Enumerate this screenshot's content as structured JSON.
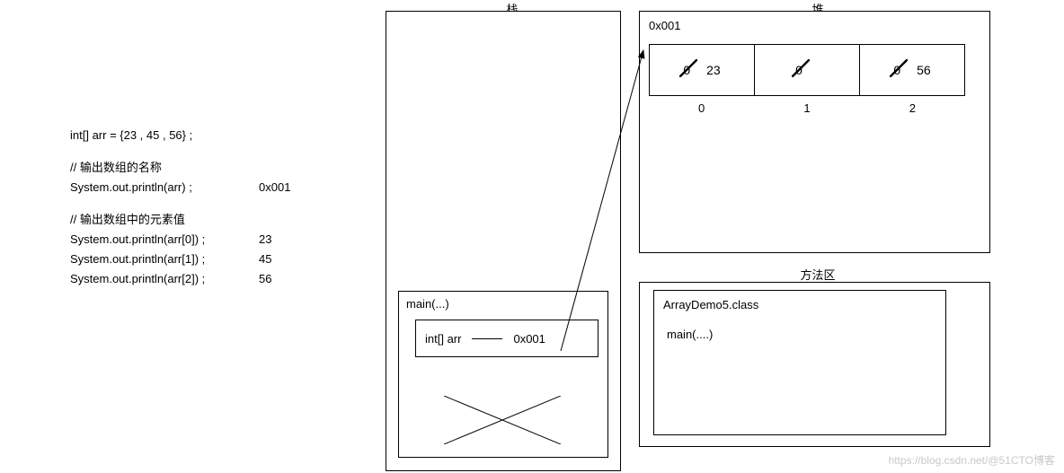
{
  "labels": {
    "stack": "栈",
    "heap": "堆",
    "method_area": "方法区"
  },
  "code": {
    "declaration": "int[] arr = {23 , 45 , 56} ;",
    "comment1": "// 输出数组的名称",
    "print_arr": "System.out.println(arr) ;",
    "print_arr_result": "0x001",
    "comment2": "// 输出数组中的元素值",
    "print0": "System.out.println(arr[0]) ;",
    "print0_result": "23",
    "print1": "System.out.println(arr[1]) ;",
    "print1_result": "45",
    "print2": "System.out.println(arr[2]) ;",
    "print2_result": "56"
  },
  "stack": {
    "frame_title": "main(...)",
    "var_decl": "int[] arr",
    "var_value": "0x001"
  },
  "heap": {
    "address": "0x001",
    "cells": [
      {
        "initial": "0",
        "value": "23",
        "index": "0"
      },
      {
        "initial": "0",
        "value": "",
        "index": "1"
      },
      {
        "initial": "0",
        "value": "56",
        "index": "2"
      }
    ]
  },
  "method_area": {
    "class_name": "ArrayDemo5.class",
    "method": "main(....)"
  },
  "watermark": "https://blog.csdn.net/@51CTO博客"
}
